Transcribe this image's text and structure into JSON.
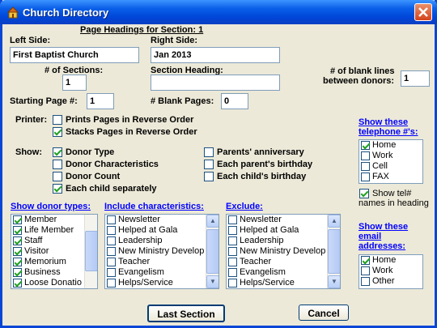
{
  "window": {
    "title": "Church Directory"
  },
  "headings": {
    "title": "Page Headings for Section: 1",
    "left_side_label": "Left Side:",
    "left_side_value": "First Baptist Church",
    "right_side_label": "Right Side:",
    "right_side_value": "Jan 2013"
  },
  "sections": {
    "num_sections_label": "# of Sections:",
    "num_sections_value": "1",
    "section_heading_label": "Section Heading:",
    "section_heading_value": "",
    "blank_lines_label_1": "# of blank lines",
    "blank_lines_label_2": "between donors:",
    "blank_lines_value": "1",
    "starting_page_label": "Starting Page #:",
    "starting_page_value": "1",
    "blank_pages_label": "# Blank Pages:",
    "blank_pages_value": "0"
  },
  "printer": {
    "label": "Printer:",
    "options": [
      {
        "label": "Prints Pages in Reverse Order",
        "checked": false
      },
      {
        "label": "Stacks Pages in Reverse Order",
        "checked": true
      }
    ]
  },
  "show": {
    "label": "Show:",
    "left": [
      {
        "label": "Donor Type",
        "checked": true
      },
      {
        "label": "Donor Characteristics",
        "checked": false
      },
      {
        "label": "Donor Count",
        "checked": false
      },
      {
        "label": "Each child separately",
        "checked": true
      }
    ],
    "right": [
      {
        "label": "Parents' anniversary",
        "checked": false
      },
      {
        "label": "Each parent's birthday",
        "checked": false
      },
      {
        "label": "Each child's birthday",
        "checked": false
      }
    ]
  },
  "telephone": {
    "heading_1": "Show these",
    "heading_2": "telephone #'s:",
    "items": [
      {
        "label": "Home",
        "checked": true
      },
      {
        "label": "Work",
        "checked": false
      },
      {
        "label": "Cell",
        "checked": false
      },
      {
        "label": "FAX",
        "checked": false
      }
    ],
    "show_tel_label_1": "Show tel#",
    "show_tel_label_2": "names in heading",
    "show_tel_checked": true
  },
  "donor_types": {
    "heading": "Show donor types:",
    "items": [
      {
        "label": "Member",
        "checked": true
      },
      {
        "label": "Life Member",
        "checked": true
      },
      {
        "label": "Staff",
        "checked": true
      },
      {
        "label": "Visitor",
        "checked": true
      },
      {
        "label": "Memorium",
        "checked": true
      },
      {
        "label": "Business",
        "checked": true
      },
      {
        "label": "Loose Donatio",
        "checked": true
      }
    ]
  },
  "characteristics": {
    "heading": "Include characteristics:",
    "items": [
      {
        "label": "Newsletter",
        "checked": false
      },
      {
        "label": "Helped at Gala",
        "checked": false
      },
      {
        "label": "Leadership",
        "checked": false
      },
      {
        "label": "New Ministry Develop",
        "checked": false
      },
      {
        "label": "Teacher",
        "checked": false
      },
      {
        "label": "Evangelism",
        "checked": false
      },
      {
        "label": "Helps/Service",
        "checked": false
      }
    ]
  },
  "exclude": {
    "heading": "Exclude:",
    "items": [
      {
        "label": "Newsletter",
        "checked": false
      },
      {
        "label": "Helped at Gala",
        "checked": false
      },
      {
        "label": "Leadership",
        "checked": false
      },
      {
        "label": "New Ministry Develop",
        "checked": false
      },
      {
        "label": "Teacher",
        "checked": false
      },
      {
        "label": "Evangelism",
        "checked": false
      },
      {
        "label": "Helps/Service",
        "checked": false
      }
    ]
  },
  "email": {
    "heading_1": "Show these",
    "heading_2": "email",
    "heading_3": "addresses:",
    "items": [
      {
        "label": "Home",
        "checked": true
      },
      {
        "label": "Work",
        "checked": false
      },
      {
        "label": "Other",
        "checked": false
      }
    ]
  },
  "buttons": {
    "last_section": "Last Section",
    "cancel": "Cancel"
  },
  "icons": {
    "app": "church-icon",
    "close": "close-icon",
    "scroll_up": "scroll-up-icon",
    "scroll_down": "scroll-down-icon"
  }
}
